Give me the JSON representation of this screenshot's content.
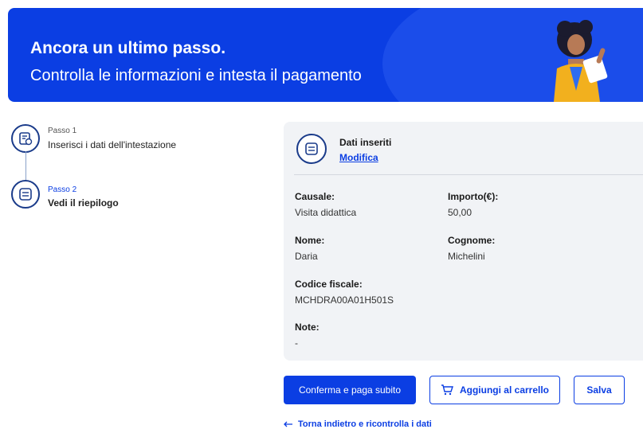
{
  "banner": {
    "title": "Ancora un ultimo passo.",
    "subtitle": "Controlla le informazioni e intesta il pagamento"
  },
  "steps": [
    {
      "label": "Passo 1",
      "text": "Inserisci i dati dell'intestazione"
    },
    {
      "label": "Passo 2",
      "text": "Vedi il riepilogo"
    }
  ],
  "summary": {
    "title": "Dati inseriti",
    "edit_link": "Modifica",
    "fields": {
      "causale_label": "Causale:",
      "causale_value": "Visita didattica",
      "importo_label": "Importo(€):",
      "importo_value": "50,00",
      "nome_label": "Nome:",
      "nome_value": "Daria",
      "cognome_label": "Cognome:",
      "cognome_value": "Michelini",
      "codice_label": "Codice fiscale:",
      "codice_value": "MCHDRA00A01H501S",
      "note_label": "Note:",
      "note_value": "-"
    }
  },
  "actions": {
    "confirm": "Conferma e paga subito",
    "add_cart": "Aggiungi al carrello",
    "save": "Salva",
    "back": "Torna indietro e ricontrolla i dati"
  },
  "colors": {
    "primary": "#0b3ee3",
    "card_bg": "#f1f3f6"
  },
  "icons": {
    "step1": "form-icon",
    "step2": "list-icon",
    "cart": "cart-icon",
    "back": "arrow-left-icon"
  }
}
